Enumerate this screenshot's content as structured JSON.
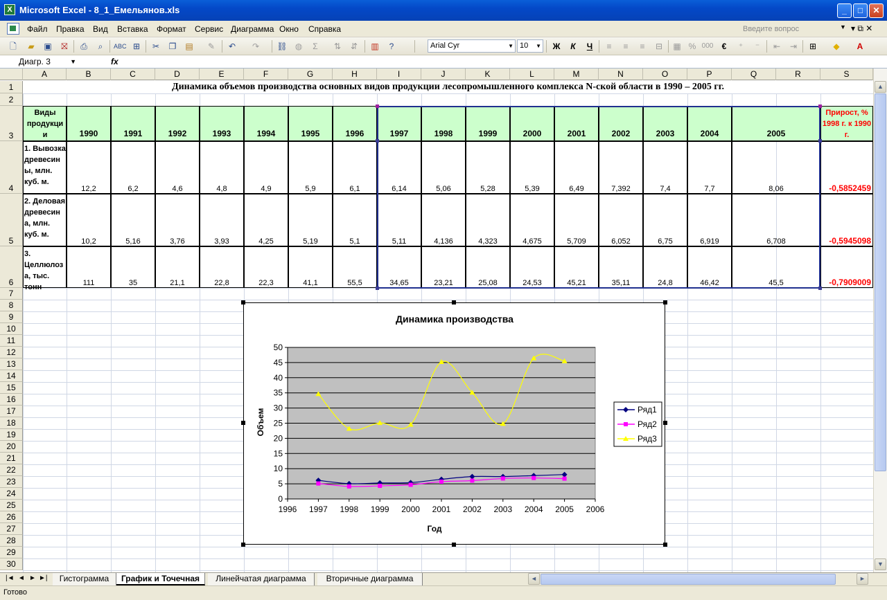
{
  "window": {
    "title": "Microsoft Excel - 8_1_Емельянов.xls",
    "app_icon": "X",
    "min_label": "_",
    "max_label": "□",
    "close_label": "✕"
  },
  "menu": {
    "items": [
      "Файл",
      "Правка",
      "Вид",
      "Вставка",
      "Формат",
      "Сервис",
      "Диаграмма",
      "Окно",
      "Справка"
    ],
    "help_placeholder": "Введите вопрос",
    "mdi_buttons": "▾  ⧉  ✕"
  },
  "toolbar": {
    "font_name": "Arial Cyr",
    "font_size": "10",
    "bold": "Ж",
    "italic": "К",
    "underline": "Ч",
    "percent": "%",
    "thousands": "000",
    "euro": "€",
    "sigma": "Σ"
  },
  "formula_bar": {
    "name_box": "Диагр. 3",
    "fx": "fx",
    "content": ""
  },
  "columns": [
    "A",
    "B",
    "C",
    "D",
    "E",
    "F",
    "G",
    "H",
    "I",
    "J",
    "K",
    "L",
    "M",
    "N",
    "O",
    "P",
    "Q",
    "R",
    "S"
  ],
  "rows": [
    "1",
    "2",
    "3",
    "4",
    "5",
    "6",
    "7",
    "8",
    "9",
    "10",
    "11",
    "12",
    "13",
    "14",
    "15",
    "16",
    "17",
    "18",
    "19",
    "20",
    "21",
    "22",
    "23",
    "24",
    "25",
    "26",
    "27",
    "28",
    "29",
    "30"
  ],
  "sheet": {
    "title": "Динамика объемов производства основных видов продукции лесопромышленного комплекса N-ской области в 1990 – 2005 гг.",
    "header_label": "Виды продукци и",
    "years": [
      "1990",
      "1991",
      "1992",
      "1993",
      "1994",
      "1995",
      "1996",
      "1997",
      "1998",
      "1999",
      "2000",
      "2001",
      "2002",
      "2003",
      "2004",
      "2005"
    ],
    "growth_header": "Прирост, % 1998 г. к 1990 г.",
    "data_rows": [
      {
        "label": "1. Вывозка древесин ы, млн. куб. м.",
        "values": [
          "12,2",
          "6,2",
          "4,6",
          "4,8",
          "4,9",
          "5,9",
          "6,1",
          "6,14",
          "5,06",
          "5,28",
          "5,39",
          "6,49",
          "7,392",
          "7,4",
          "7,7",
          "8,06"
        ],
        "growth": "-0,5852459"
      },
      {
        "label": "2. Деловая древесин а, млн. куб. м.",
        "values": [
          "10,2",
          "5,16",
          "3,76",
          "3,93",
          "4,25",
          "5,19",
          "5,1",
          "5,11",
          "4,136",
          "4,323",
          "4,675",
          "5,709",
          "6,052",
          "6,75",
          "6,919",
          "6,708"
        ],
        "growth": "-0,5945098"
      },
      {
        "label": "3. Целлюлоз а, тыс. тонн",
        "values": [
          "111",
          "35",
          "21,1",
          "22,8",
          "22,3",
          "41,1",
          "55,5",
          "34,65",
          "23,21",
          "25,08",
          "24,53",
          "45,21",
          "35,11",
          "24,8",
          "46,42",
          "45,5"
        ],
        "growth": "-0,7909009"
      }
    ]
  },
  "chart_data": {
    "type": "scatter",
    "title": "Динамика производства",
    "xlabel": "Год",
    "ylabel": "Объем",
    "xlim": [
      1996,
      2006
    ],
    "ylim": [
      0,
      50
    ],
    "x_ticks": [
      1996,
      1997,
      1998,
      1999,
      2000,
      2001,
      2002,
      2003,
      2004,
      2005,
      2006
    ],
    "y_ticks": [
      0,
      5,
      10,
      15,
      20,
      25,
      30,
      35,
      40,
      45,
      50
    ],
    "grid": true,
    "legend": "right",
    "plot_bg": "#c0c0c0",
    "x": [
      1997,
      1998,
      1999,
      2000,
      2001,
      2002,
      2003,
      2004,
      2005
    ],
    "series": [
      {
        "name": "Ряд1",
        "color": "#000080",
        "marker": "diamond",
        "values": [
          6.14,
          5.06,
          5.28,
          5.39,
          6.49,
          7.392,
          7.4,
          7.7,
          8.06
        ]
      },
      {
        "name": "Ряд2",
        "color": "#ff00ff",
        "marker": "square",
        "values": [
          5.11,
          4.136,
          4.323,
          4.675,
          5.709,
          6.052,
          6.75,
          6.919,
          6.708
        ]
      },
      {
        "name": "Ряд3",
        "color": "#ffff00",
        "marker": "triangle",
        "values": [
          34.65,
          23.21,
          25.08,
          24.53,
          45.21,
          35.11,
          24.8,
          46.42,
          45.5
        ]
      }
    ]
  },
  "tabs": {
    "nav": [
      "|◄",
      "◄",
      "►",
      "►|"
    ],
    "items": [
      "Гистограмма",
      "График и Точечная",
      "Линейчатая диаграмма",
      "Вторичные диаграмма"
    ],
    "active": 1
  },
  "status": {
    "text": "Готово"
  }
}
